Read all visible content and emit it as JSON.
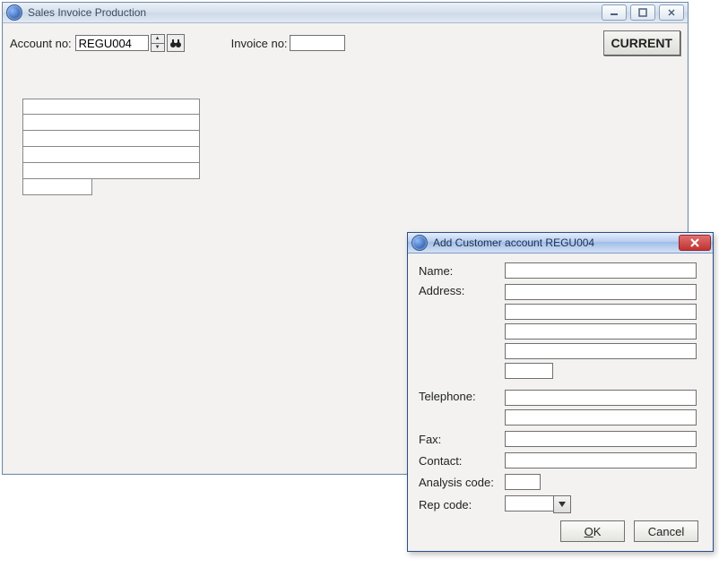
{
  "main": {
    "title": "Sales Invoice Production",
    "account_label": "Account no:",
    "account_value": "REGU004",
    "invoice_label": "Invoice no:",
    "invoice_value": "",
    "current_label": "CURRENT",
    "address_lines": [
      "",
      "",
      "",
      "",
      "",
      ""
    ]
  },
  "dialog": {
    "title": "Add Customer account REGU004",
    "labels": {
      "name": "Name:",
      "address": "Address:",
      "telephone": "Telephone:",
      "fax": "Fax:",
      "contact": "Contact:",
      "analysis_code": "Analysis code:",
      "rep_code": "Rep code:"
    },
    "values": {
      "name": "",
      "address": [
        "",
        "",
        "",
        "",
        ""
      ],
      "telephone": [
        "",
        ""
      ],
      "fax": "",
      "contact": "",
      "analysis_code": "",
      "rep_code": ""
    },
    "buttons": {
      "ok": "OK",
      "cancel": "Cancel"
    }
  }
}
